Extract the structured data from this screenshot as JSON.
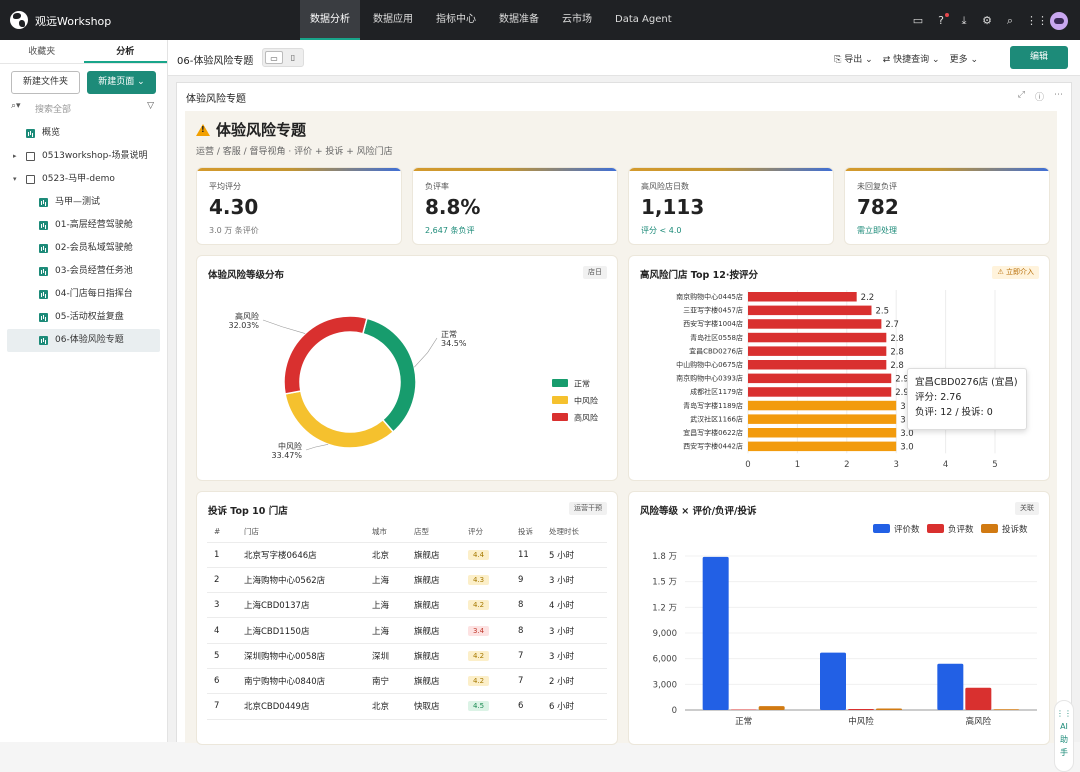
{
  "topbar": {
    "brand": "观远Workshop",
    "nav": [
      "数据分析",
      "数据应用",
      "指标中心",
      "数据准备",
      "云市场",
      "Data Agent"
    ],
    "active": 0
  },
  "sidebar": {
    "tabs": [
      "收藏夹",
      "分析"
    ],
    "active_tab": 1,
    "new_folder": "新建文件夹",
    "new_page": "新建页面",
    "search_placeholder": "搜索全部",
    "tree": [
      {
        "label": "概览",
        "type": "chart",
        "level": 0
      },
      {
        "label": "0513workshop-场景说明",
        "type": "folder",
        "level": 0,
        "caret": "▸"
      },
      {
        "label": "0523-马甲-demo",
        "type": "folder",
        "level": 0,
        "caret": "▾"
      },
      {
        "label": "马甲—测试",
        "type": "chart",
        "level": 1
      },
      {
        "label": "01-高层经营驾驶舱",
        "type": "chart",
        "level": 1
      },
      {
        "label": "02-会员私域驾驶舱",
        "type": "chart",
        "level": 1
      },
      {
        "label": "03-会员经营任务池",
        "type": "chart",
        "level": 1
      },
      {
        "label": "04-门店每日指挥台",
        "type": "chart",
        "level": 1
      },
      {
        "label": "05-活动权益复盘",
        "type": "chart",
        "level": 1
      },
      {
        "label": "06-体验风险专题",
        "type": "chart",
        "level": 1,
        "active": true
      }
    ]
  },
  "header": {
    "title": "06-体验风险专题",
    "actions": [
      "导出",
      "快捷查询",
      "更多"
    ],
    "edit": "编辑"
  },
  "panel": {
    "title": "体验风险专题"
  },
  "dashboard": {
    "title": "体验风险专题",
    "subtitle": "运营 / 客服 / 督导视角 · 评价 + 投诉 + 风险门店",
    "kpis": [
      {
        "label": "平均评分",
        "value": "4.30",
        "sub": "3.0 万 条评价",
        "teal": false
      },
      {
        "label": "负评率",
        "value": "8.8%",
        "sub": "2,647 条负评",
        "teal": true
      },
      {
        "label": "高风险店日数",
        "value": "1,113",
        "sub": "评分 < 4.0",
        "teal": true
      },
      {
        "label": "未回复负评",
        "value": "782",
        "sub": "需立即处理",
        "teal": true
      }
    ]
  },
  "donut_card": {
    "title": "体验风险等级分布",
    "tag": "店日"
  },
  "bar_card": {
    "title": "高风险门店 Top 12·按评分",
    "tag": "立即介入"
  },
  "table_card": {
    "title": "投诉 Top 10 门店",
    "tag": "运营干预",
    "headers": [
      "#",
      "门店",
      "城市",
      "店型",
      "评分",
      "投诉",
      "处理时长"
    ],
    "rows": [
      [
        "1",
        "北京写字楼0646店",
        "北京",
        "旗舰店",
        "4.4",
        "11",
        "5 小时"
      ],
      [
        "2",
        "上海购物中心0562店",
        "上海",
        "旗舰店",
        "4.3",
        "9",
        "3 小时"
      ],
      [
        "3",
        "上海CBD0137店",
        "上海",
        "旗舰店",
        "4.2",
        "8",
        "4 小时"
      ],
      [
        "4",
        "上海CBD1150店",
        "上海",
        "旗舰店",
        "3.4",
        "8",
        "3 小时"
      ],
      [
        "5",
        "深圳购物中心0058店",
        "深圳",
        "旗舰店",
        "4.2",
        "7",
        "3 小时"
      ],
      [
        "6",
        "南宁购物中心0840店",
        "南宁",
        "旗舰店",
        "4.2",
        "7",
        "2 小时"
      ],
      [
        "7",
        "北京CBD0449店",
        "北京",
        "快取店",
        "4.5",
        "6",
        "6 小时"
      ]
    ]
  },
  "group_card": {
    "title": "风险等级 × 评价/负评/投诉",
    "tag": "关联"
  },
  "tooltip": {
    "title": "宜昌CBD0276店 (宜昌)",
    "line1": "评分: 2.76",
    "line2": "负评: 12 / 投诉: 0"
  },
  "ai": {
    "label1": "AI",
    "label2": "助",
    "label3": "手"
  },
  "colors": {
    "accent": "#1d8b79",
    "green": "#179c6d",
    "yellow": "#f5c12e",
    "red": "#d9302f",
    "orange": "#f29b0d",
    "blue": "#2260e5",
    "brown": "#d17a12"
  },
  "chart_data": [
    {
      "type": "pie",
      "title": "体验风险等级分布",
      "legend": [
        "正常",
        "中风险",
        "高风险"
      ],
      "legend_position": "right",
      "slices": [
        {
          "name": "正常",
          "value": 34.5,
          "label": "34.5%"
        },
        {
          "name": "中风险",
          "value": 33.47,
          "label": "33.47%"
        },
        {
          "name": "高风险",
          "value": 32.03,
          "label": "32.03%"
        }
      ]
    },
    {
      "type": "bar",
      "orientation": "horizontal",
      "title": "高风险门店 Top 12·按评分",
      "xlim": [
        0,
        5
      ],
      "xticks": [
        "0",
        "1",
        "2",
        "3",
        "4",
        "5"
      ],
      "grid": true,
      "categories": [
        "南京购物中心0445店",
        "三亚写字楼0457店",
        "西安写字楼1004店",
        "青岛社区0558店",
        "宜昌CBD0276店",
        "中山购物中心0675店",
        "南京购物中心0393店",
        "成都社区1179店",
        "青岛写字楼1189店",
        "武汉社区1166店",
        "宜昌写字楼0622店",
        "西安写字楼0442店"
      ],
      "values": [
        2.2,
        2.5,
        2.7,
        2.8,
        2.8,
        2.8,
        2.9,
        2.9,
        3.0,
        3.0,
        3.0,
        3.0
      ],
      "labels": [
        "2.2",
        "2.5",
        "2.7",
        "2.8",
        "2.8",
        "2.8",
        "2.9",
        "2.9",
        "3",
        "3",
        "3.0",
        "3.0"
      ],
      "colors": [
        "red",
        "red",
        "red",
        "red",
        "red",
        "red",
        "red",
        "red",
        "orange",
        "orange",
        "orange",
        "orange"
      ]
    },
    {
      "type": "bar",
      "title": "风险等级 × 评价/负评/投诉",
      "categories": [
        "正常",
        "中风险",
        "高风险"
      ],
      "ylim": [
        0,
        18000
      ],
      "yticks": [
        "0",
        "3,000",
        "6,000",
        "9,000",
        "1.2 万",
        "1.5 万",
        "1.8 万"
      ],
      "legend_position": "top-right",
      "series": [
        {
          "name": "评价数",
          "values": [
            17900,
            6700,
            5400
          ]
        },
        {
          "name": "负评数",
          "values": [
            60,
            120,
            2600
          ]
        },
        {
          "name": "投诉数",
          "values": [
            450,
            180,
            90
          ]
        }
      ]
    }
  ]
}
